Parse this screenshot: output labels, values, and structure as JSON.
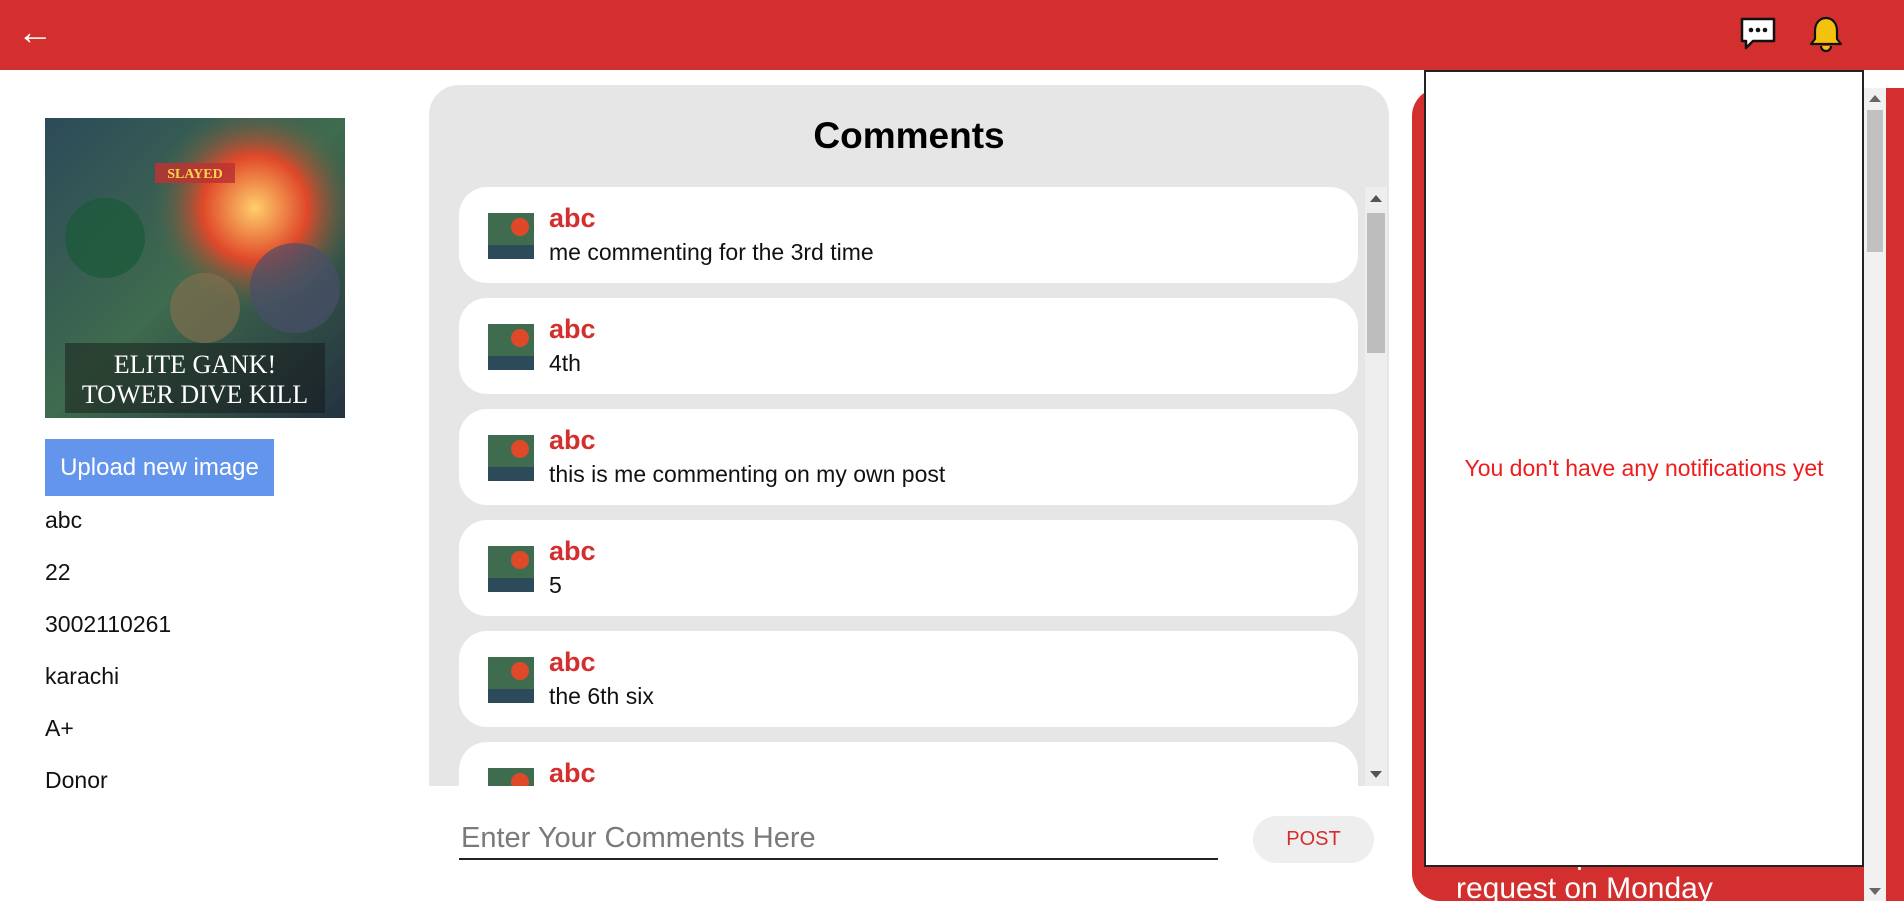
{
  "header": {
    "back_glyph": "←",
    "chat_icon": "chat-bubble-icon",
    "bell_icon": "bell-icon",
    "brand_color": "#d32f2f",
    "bell_color": "#f4c20d"
  },
  "profile": {
    "image_caption_line1": "ELITE GANK!",
    "image_caption_line2": "TOWER DIVE KILL",
    "image_banner": "SLAYED",
    "upload_label": "Upload new image",
    "name": "abc",
    "age": "22",
    "phone": "3002110261",
    "city": "karachi",
    "blood_group": "A+",
    "role": "Donor"
  },
  "comments": {
    "title": "Comments",
    "items": [
      {
        "name": "abc",
        "text": "me commenting for the 3rd time"
      },
      {
        "name": "abc",
        "text": "4th"
      },
      {
        "name": "abc",
        "text": "this is me commenting on my own post"
      },
      {
        "name": "abc",
        "text": "5"
      },
      {
        "name": "abc",
        "text": "the 6th six"
      },
      {
        "name": "abc",
        "text": ""
      }
    ],
    "input_placeholder": "Enter Your Comments Here",
    "post_label": "POST"
  },
  "notifications": {
    "empty_message": "You don't have any notifications yet",
    "background_text": "abc accepted b's blood request on Monday"
  }
}
